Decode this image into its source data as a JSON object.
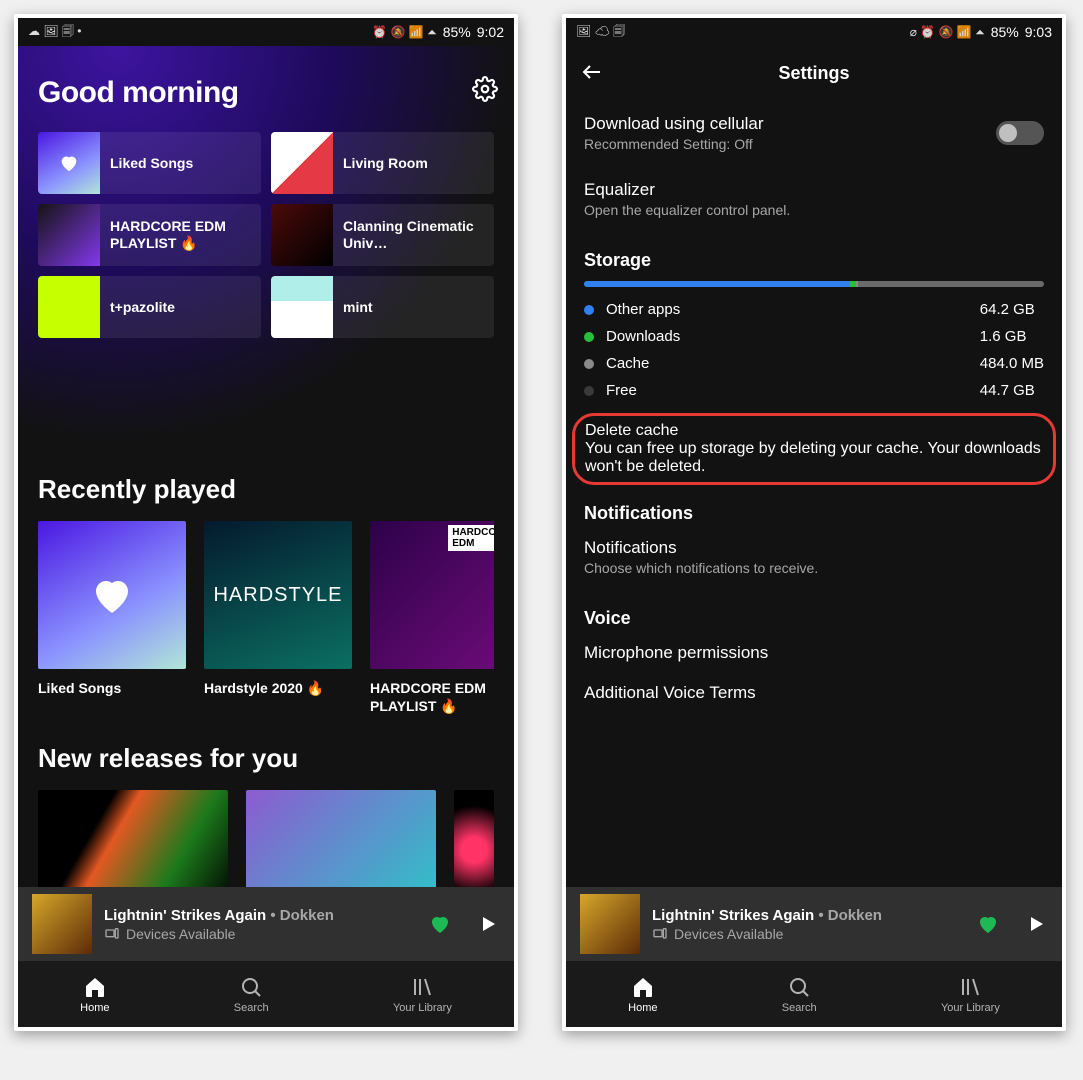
{
  "phone_left": {
    "status": {
      "time": "9:02",
      "battery": "85%",
      "indicators_left": "☁ 🖼 🗐 •",
      "indicators_right": "⏰ 🔕 📶 ⏶"
    },
    "settings_icon_name": "gear-icon",
    "greeting": "Good morning",
    "quick": [
      {
        "label": "Liked Songs",
        "art": "liked"
      },
      {
        "label": "Living Room",
        "art": "ajr"
      },
      {
        "label": "HARDCORE EDM PLAYLIST 🔥",
        "art": "hardcore"
      },
      {
        "label": "Clanning Cinematic Univ…",
        "art": "clanning"
      },
      {
        "label": "t+pazolite",
        "art": "tpazolite"
      },
      {
        "label": "mint",
        "art": "mint"
      }
    ],
    "section_recent": "Recently played",
    "recent": [
      {
        "title": "Liked Songs",
        "art": "liked"
      },
      {
        "title": "Hardstyle 2020 🔥",
        "art": "hardstyle"
      },
      {
        "title": "HARDCORE EDM PLAYLIST 🔥",
        "art": "hardcore"
      }
    ],
    "section_new": "New releases for you"
  },
  "phone_right": {
    "status": {
      "time": "9:03",
      "battery": "85%",
      "indicators_left": "🖼 ☁ 🗐",
      "indicators_right": "⌀ ⏰ 🔕 📶 ⏶"
    },
    "title": "Settings",
    "rows": {
      "download_cell": {
        "title": "Download using cellular",
        "sub": "Recommended Setting: Off",
        "toggle": false
      },
      "equalizer": {
        "title": "Equalizer",
        "sub": "Open the equalizer control panel."
      }
    },
    "storage": {
      "heading": "Storage",
      "bar": [
        {
          "color": "#3180f0",
          "pct": 57.8
        },
        {
          "color": "#27c03b",
          "pct": 1.4
        },
        {
          "color": "#8a8a8a",
          "pct": 0.4
        }
      ],
      "legend": [
        {
          "label": "Other apps",
          "value": "64.2 GB",
          "color": "#3180f0"
        },
        {
          "label": "Downloads",
          "value": "1.6 GB",
          "color": "#27c03b"
        },
        {
          "label": "Cache",
          "value": "484.0 MB",
          "color": "#8a8a8a"
        },
        {
          "label": "Free",
          "value": "44.7 GB",
          "color": "#3a3a3a"
        }
      ],
      "delete": {
        "title": "Delete cache",
        "sub": "You can free up storage by deleting your cache. Your downloads won't be deleted."
      }
    },
    "notifications": {
      "heading": "Notifications",
      "title": "Notifications",
      "sub": "Choose which notifications to receive."
    },
    "voice": {
      "heading": "Voice",
      "mic": "Microphone permissions",
      "terms": "Additional Voice Terms"
    }
  },
  "now_playing": {
    "song": "Lightnin' Strikes Again",
    "sep": " • ",
    "artist": "Dokken",
    "devices": "Devices Available"
  },
  "nav": {
    "home": "Home",
    "search": "Search",
    "library": "Your Library"
  }
}
